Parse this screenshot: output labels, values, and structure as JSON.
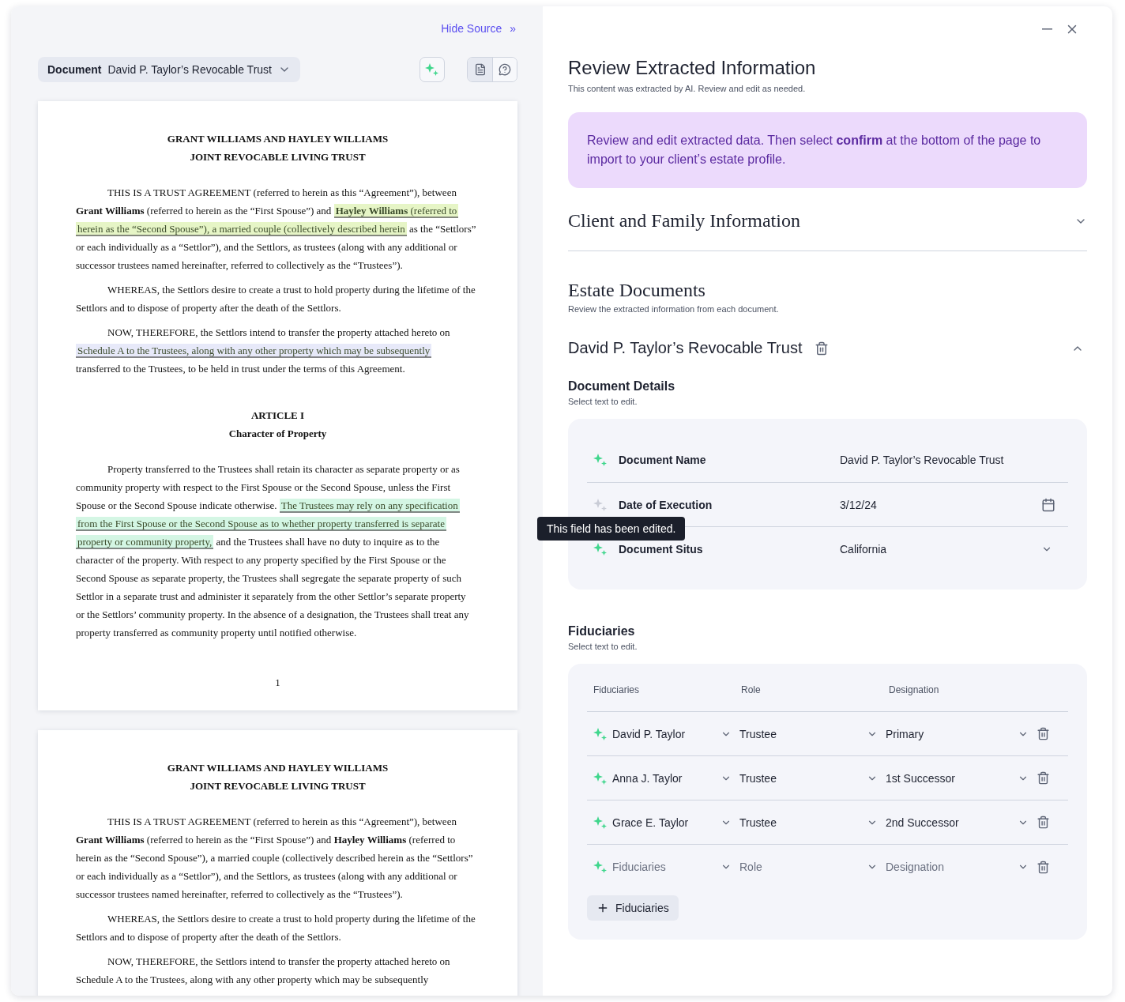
{
  "source_panel": {
    "hide_link": "Hide Source",
    "hide_icon": "»",
    "document_label": "Document",
    "document_value": "David P. Taylor’s Revocable Trust",
    "view_toggle": [
      {
        "kind": "document",
        "selected": true
      },
      {
        "kind": "chat",
        "selected": false
      }
    ]
  },
  "pages": [
    {
      "blocks": [
        {
          "kind": "title",
          "lines": [
            [
              "GRANT WILLIAMS AND HAYLEY WILLIAMS"
            ],
            [
              "JOINT REVOCABLE LIVING TRUST"
            ]
          ]
        },
        {
          "kind": "paragraph",
          "lines": [
            [
              "THIS IS A TRUST AGREEMENT (referred to herein as this “Agreement”), between"
            ],
            [
              "**Grant Williams** (referred to herein as the “First Spouse”) and ",
              {
                "text": "**Hayley Williams** (referred to",
                "color": "#e6f5c6"
              }
            ],
            [
              {
                "text": "herein as the “Second Spouse”), a married couple (collectively described herein",
                "color": "#e6f5c6"
              },
              " as the “Settlors”"
            ],
            [
              "or each individually as a “Settlor”), and the Settlors, as trustees (along with any additional or"
            ],
            [
              "successor trustees named hereinafter, referred to collectively as the “Trustees”)."
            ]
          ]
        },
        {
          "kind": "paragraph",
          "lines": [
            [
              "WHEREAS, the Settlors desire to create a trust to hold property during the lifetime of the"
            ],
            [
              "Settlors and to dispose of property after the death of the Settlors."
            ]
          ]
        },
        {
          "kind": "paragraph",
          "lines": [
            [
              "NOW, THEREFORE, the Settlors intend to transfer the property attached hereto on"
            ],
            [
              {
                "text": "Schedule A to the Trustees, along with any other property which may be subsequently",
                "color": "#e7e9f9"
              }
            ],
            [
              "transferred to the Trustees, to be held in trust under the terms of this Agreement."
            ]
          ]
        },
        {
          "kind": "title",
          "lines": [
            [
              "ARTICLE I"
            ],
            [
              "Character of Property"
            ]
          ]
        },
        {
          "kind": "paragraph",
          "lines": [
            [
              "Property transferred to the Trustees shall retain its character as separate property or as"
            ],
            [
              "community property with respect to the First Spouse or the Second Spouse, unless the First"
            ],
            [
              "Spouse or the Second Spouse indicate otherwise. ",
              {
                "text": "The Trustees may rely on any specification",
                "color": "#d4f6e4"
              }
            ],
            [
              {
                "text": "from the First Spouse or the Second Spouse as to whether property transferred is separate",
                "color": "#d4f6e4"
              }
            ],
            [
              {
                "text": "property or community property,",
                "color": "#d4f6e4"
              },
              " and the Trustees shall have no duty to inquire as to the"
            ],
            [
              "character of the property.  With respect to any property specified by the First Spouse or the"
            ],
            [
              "Second Spouse as separate property, the Trustees shall segregate the separate property of such"
            ],
            [
              "Settlor in a separate trust and administer it separately from the other Settlor’s separate property"
            ],
            [
              "or the Settlors’ community property.  In the absence of a designation, the Trustees shall treat any"
            ],
            [
              "property transferred as community property until notified otherwise."
            ]
          ]
        },
        {
          "kind": "page_number",
          "lines": [
            [
              "1"
            ]
          ]
        }
      ]
    },
    {
      "blocks": [
        {
          "kind": "title",
          "lines": [
            [
              "GRANT WILLIAMS AND HAYLEY WILLIAMS"
            ],
            [
              "JOINT REVOCABLE LIVING TRUST"
            ]
          ]
        },
        {
          "kind": "paragraph",
          "lines": [
            [
              "THIS IS A TRUST AGREEMENT (referred to herein as this “Agreement”), between"
            ],
            [
              "**Grant Williams** (referred to herein as the “First Spouse”) and **Hayley Williams** (referred to"
            ],
            [
              "herein as the “Second Spouse”), a married couple (collectively described herein as the “Settlors”"
            ],
            [
              "or each individually as a “Settlor”), and the Settlors, as trustees (along with any additional or"
            ],
            [
              "successor trustees named hereinafter, referred to collectively as the “Trustees”)."
            ]
          ]
        },
        {
          "kind": "paragraph",
          "lines": [
            [
              "WHEREAS, the Settlors desire to create a trust to hold property during the lifetime of the"
            ],
            [
              "Settlors and to dispose of property after the death of the Settlors."
            ]
          ]
        },
        {
          "kind": "paragraph",
          "lines": [
            [
              "NOW, THEREFORE, the Settlors intend to transfer the property attached hereto on"
            ],
            [
              "Schedule A to the Trustees, along with any other property which may be subsequently"
            ]
          ]
        }
      ]
    }
  ],
  "review": {
    "title": "Review Extracted Information",
    "subtitle": "This content was extracted by AI. Review and edit as needed.",
    "notice": "Review and edit extracted data. Then select **confirm** at the bottom of the page to import to your client’s estate profile."
  },
  "client_section": {
    "title": "Client and Family Information",
    "expanded": false
  },
  "estate_documents": {
    "title": "Estate Documents",
    "subtitle": "Review the extracted information from each document.",
    "document": {
      "title": "David P. Taylor’s Revocable Trust",
      "expanded": true
    }
  },
  "document_details": {
    "title": "Document Details",
    "subtitle": "Select text to edit.",
    "fields": [
      {
        "kind": "text",
        "label": "Document Name",
        "value": "David P. Taylor’s Revocable Trust",
        "edited": false
      },
      {
        "kind": "date",
        "label": "Date of Execution",
        "value": "3/12/24",
        "edited": true
      },
      {
        "kind": "select",
        "label": "Document Situs",
        "value": "California",
        "edited": false
      }
    ],
    "tooltip": "This field has been edited."
  },
  "fiduciaries": {
    "title": "Fiduciaries",
    "subtitle": "Select text to edit.",
    "columns": [
      "Fiduciaries",
      "Role",
      "Designation"
    ],
    "rows": [
      {
        "name": "David P. Taylor",
        "role": "Trustee",
        "designation": "Primary",
        "empty": false
      },
      {
        "name": "Anna J. Taylor",
        "role": "Trustee",
        "designation": "1st Successor",
        "empty": false
      },
      {
        "name": "Grace E. Taylor",
        "role": "Trustee",
        "designation": "2nd Successor",
        "empty": false
      },
      {
        "name": "Fiduciaries",
        "role": "Role",
        "designation": "Designation",
        "empty": true
      }
    ],
    "add_button": "Fiduciaries"
  }
}
